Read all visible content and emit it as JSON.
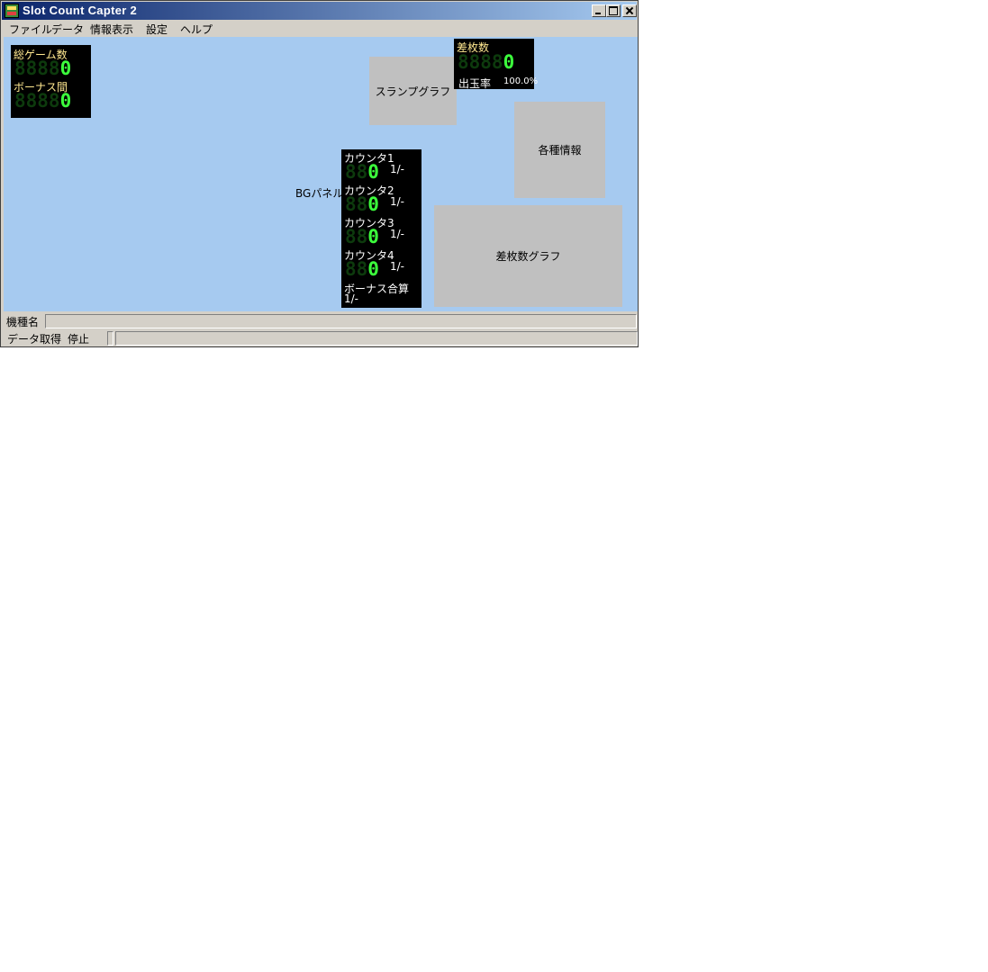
{
  "window": {
    "title": "Slot Count Capter 2"
  },
  "menu": [
    "ファイル",
    "データ",
    "情報表示",
    "設定",
    "ヘルプ"
  ],
  "left_panel": {
    "total_games_label": "総ゲーム数",
    "total_games_dim": "8888",
    "total_games_value": "0",
    "bonus_interval_label": "ボーナス間",
    "bonus_interval_dim": "8888",
    "bonus_interval_value": "0"
  },
  "diff_panel": {
    "label": "差枚数",
    "dim": "8888",
    "value": "0",
    "payout_label": "出玉率",
    "payout_value": "100.0%"
  },
  "counter_panel": {
    "counters": [
      {
        "label": "カウンタ1",
        "dim": "88",
        "value": "0",
        "ratio": "1/-"
      },
      {
        "label": "カウンタ2",
        "dim": "88",
        "value": "0",
        "ratio": "1/-"
      },
      {
        "label": "カウンタ3",
        "dim": "88",
        "value": "0",
        "ratio": "1/-"
      },
      {
        "label": "カウンタ4",
        "dim": "88",
        "value": "0",
        "ratio": "1/-"
      }
    ],
    "bonus_total_label": "ボーナス合算",
    "bonus_total_ratio": "1/-"
  },
  "bg_panel_label": "BGパネル",
  "slump_graph_label": "スランプグラフ",
  "info_label": "各種情報",
  "diff_graph_label": "差枚数グラフ",
  "status": {
    "model_label": "機種名",
    "model_value": "",
    "data_label": "データ取得",
    "data_state": "停止"
  },
  "colors": {
    "client_bg": "#a6caf0",
    "segment_lit": "#3cff3c",
    "label_yellow": "#ffe890"
  }
}
